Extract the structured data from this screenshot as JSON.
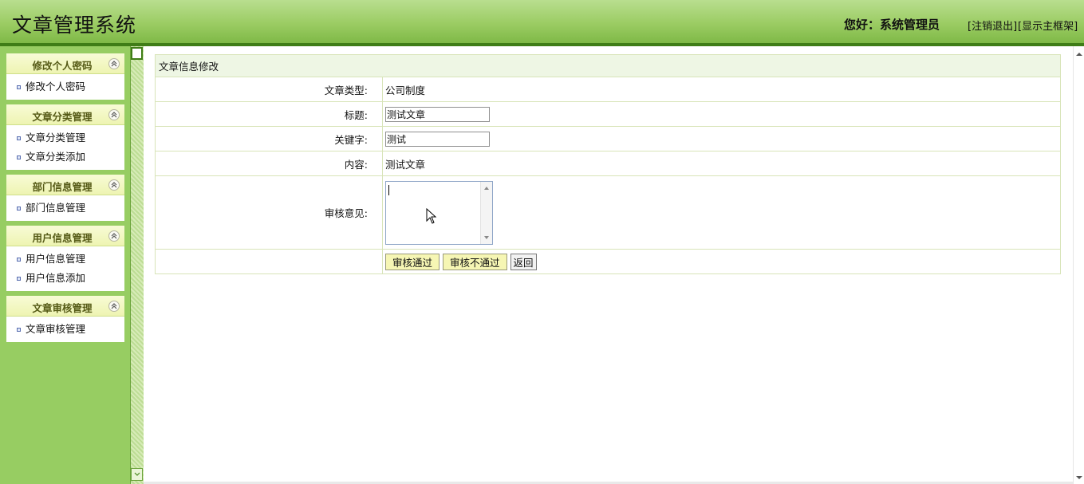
{
  "header": {
    "app_title": "文章管理系统",
    "greeting": "您好：系统管理员",
    "logout_link": "[注销退出]",
    "show_frame_link": "[显示主框架]"
  },
  "sidebar": {
    "groups": [
      {
        "title": "修改个人密码",
        "items": [
          {
            "label": "修改个人密码"
          }
        ]
      },
      {
        "title": "文章分类管理",
        "items": [
          {
            "label": "文章分类管理"
          },
          {
            "label": "文章分类添加"
          }
        ]
      },
      {
        "title": "部门信息管理",
        "items": [
          {
            "label": "部门信息管理"
          }
        ]
      },
      {
        "title": "用户信息管理",
        "items": [
          {
            "label": "用户信息管理"
          },
          {
            "label": "用户信息添加"
          }
        ]
      },
      {
        "title": "文章审核管理",
        "items": [
          {
            "label": "文章审核管理"
          }
        ]
      }
    ]
  },
  "form": {
    "title": "文章信息修改",
    "article_type_label": "文章类型:",
    "article_type_value": "公司制度",
    "title_label": "标题:",
    "title_value": "测试文章",
    "keyword_label": "关键字:",
    "keyword_value": "测试",
    "content_label": "内容:",
    "content_value": "测试文章",
    "review_label": "审核意见:",
    "review_value": "",
    "approve_button": "审核通过",
    "reject_button": "审核不通过",
    "back_button": "返回"
  },
  "colors": {
    "header_green": "#9bcc63",
    "header_border": "#3f7d17",
    "sidebar_bg": "#97cd62",
    "menu_title": "#555a16",
    "table_border": "#d8e4b8",
    "button_yellow": "#f6f6b4"
  }
}
